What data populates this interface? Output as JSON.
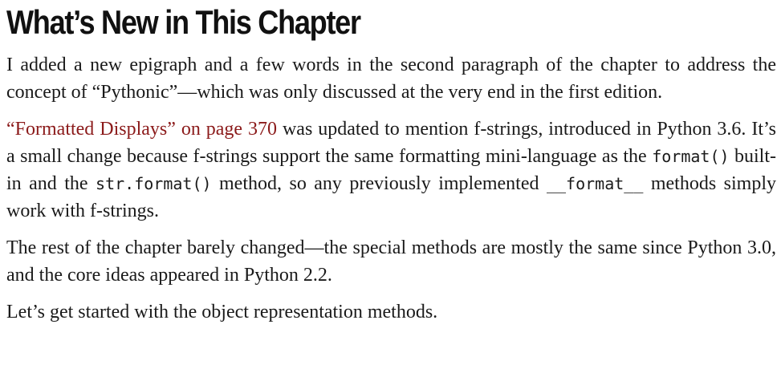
{
  "heading": "What’s New in This Chapter",
  "p1": "I added a new epigraph and a few words in the second paragraph of the chapter to address the concept of “Pythonic”—which was only discussed at the very end in the first edition.",
  "p2": {
    "link_text": "“Formatted Displays” on page 370",
    "text_1": " was updated to mention f-strings, introduced in Python 3.6. It’s a small change because f-strings support the same formatting mini-language as the ",
    "code_1": "format()",
    "text_2": " built-in and the ",
    "code_2": "str.format()",
    "text_3": " method, so any previously implemented ",
    "code_3": "__format__",
    "text_4": " methods simply work with f-strings."
  },
  "p3": "The rest of the chapter barely changed—the special methods are mostly the same since Python 3.0, and the core ideas appeared in Python 2.2.",
  "p4": "Let’s get started with the object representation methods.",
  "colors": {
    "link": "#8b1a1a",
    "text": "#1a1a1a"
  }
}
